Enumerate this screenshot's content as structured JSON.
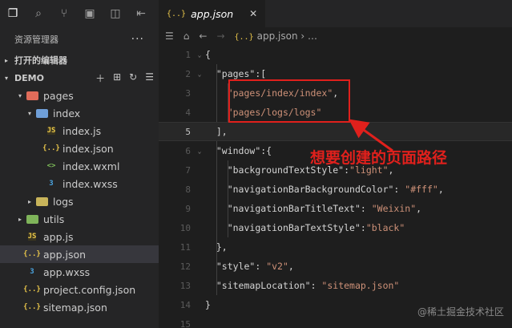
{
  "sidebar": {
    "title": "资源管理器",
    "more": "···",
    "open_editors_label": "打开的编辑器",
    "project_label": "DEMO",
    "tree": [
      {
        "label": "pages",
        "indent": 1,
        "twist": "▾",
        "icon": "folder-red"
      },
      {
        "label": "index",
        "indent": 2,
        "twist": "▾",
        "icon": "folder-blue"
      },
      {
        "label": "index.js",
        "indent": 3,
        "twist": "",
        "icon": "js"
      },
      {
        "label": "index.json",
        "indent": 3,
        "twist": "",
        "icon": "json"
      },
      {
        "label": "index.wxml",
        "indent": 3,
        "twist": "",
        "icon": "wxml"
      },
      {
        "label": "index.wxss",
        "indent": 3,
        "twist": "",
        "icon": "wxss"
      },
      {
        "label": "logs",
        "indent": 2,
        "twist": "▸",
        "icon": "folder-yellow"
      },
      {
        "label": "utils",
        "indent": 1,
        "twist": "▸",
        "icon": "folder-green"
      },
      {
        "label": "app.js",
        "indent": 1,
        "twist": "",
        "icon": "js"
      },
      {
        "label": "app.json",
        "indent": 1,
        "twist": "",
        "icon": "json",
        "selected": true
      },
      {
        "label": "app.wxss",
        "indent": 1,
        "twist": "",
        "icon": "wxss"
      },
      {
        "label": "project.config.json",
        "indent": 1,
        "twist": "",
        "icon": "json"
      },
      {
        "label": "sitemap.json",
        "indent": 1,
        "twist": "",
        "icon": "json"
      }
    ]
  },
  "editor": {
    "tab_label": "app.json",
    "tab_icon": "{..}",
    "breadcrumb_file": "app.json",
    "breadcrumb_more": "…",
    "current_line": 5,
    "lines": [
      {
        "n": 1,
        "text": "{"
      },
      {
        "n": 2,
        "text": "  \"pages\":["
      },
      {
        "n": 3,
        "text": "    \"pages/index/index\","
      },
      {
        "n": 4,
        "text": "    \"pages/logs/logs\""
      },
      {
        "n": 5,
        "text": "  ],"
      },
      {
        "n": 6,
        "text": "  \"window\":{"
      },
      {
        "n": 7,
        "text": "    \"backgroundTextStyle\":\"light\","
      },
      {
        "n": 8,
        "text": "    \"navigationBarBackgroundColor\": \"#fff\","
      },
      {
        "n": 9,
        "text": "    \"navigationBarTitleText\": \"Weixin\","
      },
      {
        "n": 10,
        "text": "    \"navigationBarTextStyle\":\"black\""
      },
      {
        "n": 11,
        "text": "  },"
      },
      {
        "n": 12,
        "text": "  \"style\": \"v2\","
      },
      {
        "n": 13,
        "text": "  \"sitemapLocation\": \"sitemap.json\""
      },
      {
        "n": 14,
        "text": "}"
      },
      {
        "n": 15,
        "text": ""
      }
    ]
  },
  "annotation": {
    "text": "想要创建的页面路径",
    "color": "#e0201c"
  },
  "watermark": "@稀土掘金技术社区",
  "colors": {
    "background": "#1e1e1e",
    "sidebar": "#252526",
    "string": "#ce9178",
    "accent_red": "#e0201c"
  }
}
